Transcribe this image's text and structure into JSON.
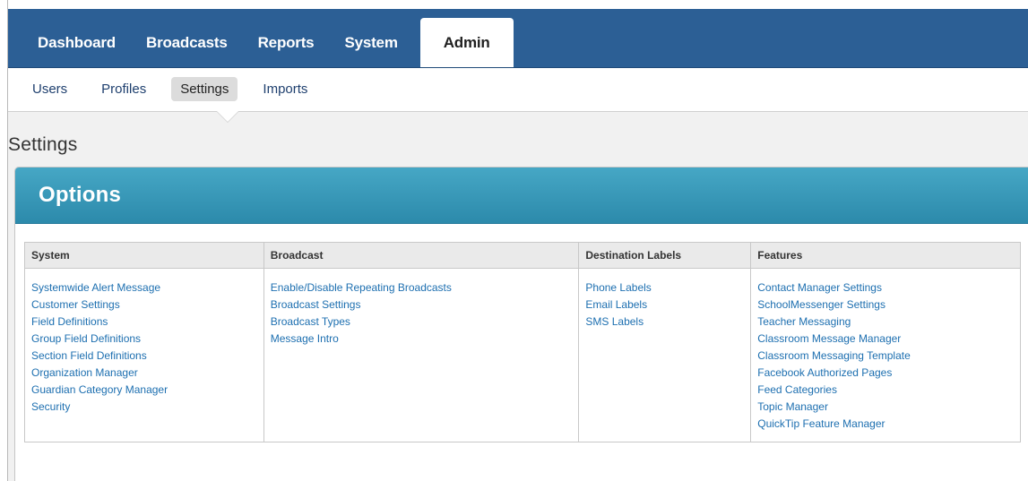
{
  "top_nav": {
    "items": [
      {
        "label": "Dashboard"
      },
      {
        "label": "Broadcasts"
      },
      {
        "label": "Reports"
      },
      {
        "label": "System"
      },
      {
        "label": "Admin",
        "active": true
      }
    ]
  },
  "sub_nav": {
    "items": [
      {
        "label": "Users"
      },
      {
        "label": "Profiles"
      },
      {
        "label": "Settings",
        "active": true
      },
      {
        "label": "Imports"
      }
    ]
  },
  "page": {
    "title": "Settings"
  },
  "options": {
    "title": "Options",
    "columns": [
      {
        "header": "System",
        "links": [
          "Systemwide Alert Message",
          "Customer Settings",
          "Field Definitions",
          "Group Field Definitions",
          "Section Field Definitions",
          "Organization Manager",
          "Guardian Category Manager",
          "Security"
        ]
      },
      {
        "header": "Broadcast",
        "links": [
          "Enable/Disable Repeating Broadcasts",
          "Broadcast Settings",
          "Broadcast Types",
          "Message Intro"
        ]
      },
      {
        "header": "Destination Labels",
        "links": [
          "Phone Labels",
          "Email Labels",
          "SMS Labels"
        ]
      },
      {
        "header": "Features",
        "links": [
          "Contact Manager Settings",
          "SchoolMessenger Settings",
          "Teacher Messaging",
          "Classroom Message Manager",
          "Classroom Messaging Template",
          "Facebook Authorized Pages",
          "Feed Categories",
          "Topic Manager",
          "QuickTip Feature Manager"
        ]
      }
    ]
  },
  "colors": {
    "topbar": "#2c5f95",
    "panel_header": "#2c8aab",
    "link": "#1d6fb0"
  }
}
